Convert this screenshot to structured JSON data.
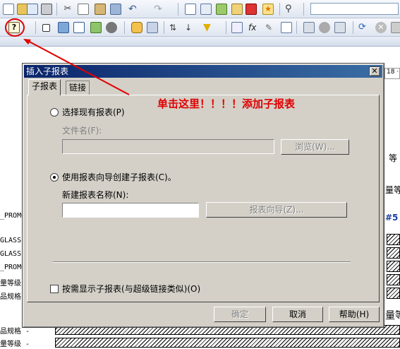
{
  "dialog": {
    "title": "插入子报表",
    "close_glyph": "✕",
    "tabs": [
      {
        "label": "子报表",
        "active": true
      },
      {
        "label": "链接",
        "active": false
      }
    ],
    "option_existing": "选择现有报表(P)",
    "file_name_label": "文件名(F):",
    "file_name_value": "",
    "browse_button": "浏览(W)...",
    "option_wizard": "使用报表向导创建子报表(C)。",
    "new_report_label": "新建报表名称(N):",
    "new_report_value": "",
    "report_wizard_button": "报表向导(Z)...",
    "on_demand_checkbox": "按需显示子报表(与超级链接类似)(O)",
    "ok_button": "确定",
    "cancel_button": "取消",
    "help_button": "帮助(H)"
  },
  "annotation": {
    "text": "单击这里！！！！添加子报表",
    "color": "#e00000"
  },
  "background": {
    "ruler_text": "18 ·",
    "left_labels": [
      "_PROMO",
      "GLASS",
      "GLASS",
      "_PROMO",
      "量等级",
      "品规格",
      "品规格 -",
      "量等级 -"
    ],
    "right_texts": [
      "等",
      "#5 ·",
      "量等",
      "量等"
    ]
  },
  "toolbar_icons": [
    "new-icon",
    "open-icon",
    "print-preview-icon",
    "print-icon",
    "cut-icon",
    "copy-icon",
    "paste-icon",
    "format-painter-icon",
    "undo-icon",
    "redo-icon",
    "insert-subreport-icon",
    "box-icon",
    "picture-icon",
    "chart-icon",
    "map-icon",
    "database-icon",
    "sort-icon",
    "filter-icon",
    "formula-icon",
    "refresh-icon",
    "stop-icon"
  ]
}
